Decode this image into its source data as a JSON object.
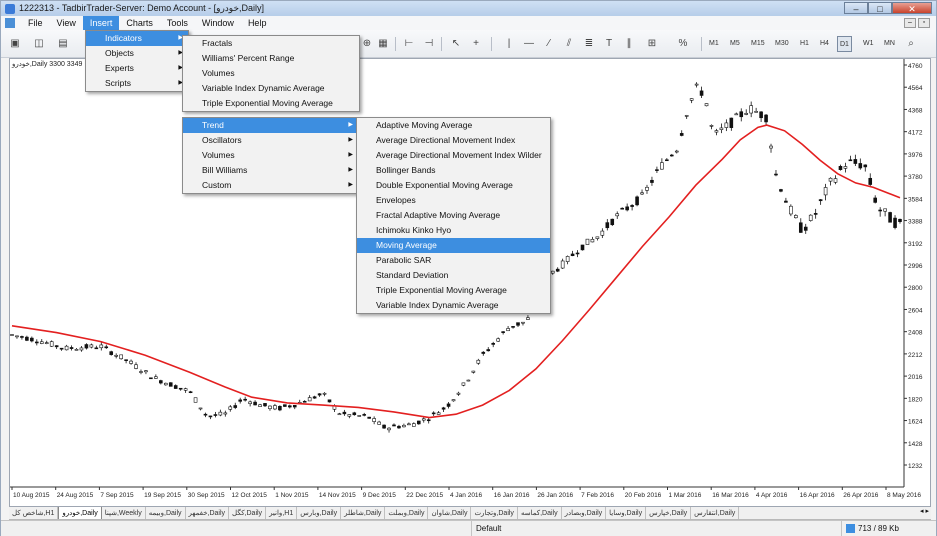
{
  "window": {
    "title": "1222313 - TadbirTrader-Server: Demo Account - [خودرو,Daily]",
    "controls": {
      "minimize": "–",
      "maximize": "□",
      "close": "✕"
    }
  },
  "menubar": {
    "items": [
      "File",
      "View",
      "Insert",
      "Charts",
      "Tools",
      "Window",
      "Help"
    ],
    "active": "Insert"
  },
  "toolbar": {
    "timeframes": [
      "M1",
      "M5",
      "M15",
      "M30",
      "H1",
      "H4",
      "D1",
      "W1",
      "MN"
    ],
    "selected_timeframe": "D1",
    "zoom_text": "%"
  },
  "chart": {
    "symbol_label": "خودرو,Daily 3300 3349",
    "price_labels": [
      "4760",
      "4564",
      "4368",
      "4172",
      "3976",
      "3780",
      "3584",
      "3388",
      "3192",
      "2996",
      "2800",
      "2604",
      "2408",
      "2212",
      "2016",
      "1820",
      "1624",
      "1428",
      "1232"
    ],
    "date_labels": [
      "10 Aug 2015",
      "24 Aug 2015",
      "7 Sep 2015",
      "19 Sep 2015",
      "30 Sep 2015",
      "12 Oct 2015",
      "1 Nov 2015",
      "14 Nov 2015",
      "9 Dec 2015",
      "22 Dec 2015",
      "4 Jan 2016",
      "16 Jan 2016",
      "26 Jan 2016",
      "7 Feb 2016",
      "20 Feb 2016",
      "1 Mar 2016",
      "16 Mar 2016",
      "4 Apr 2016",
      "16 Apr 2016",
      "26 Apr 2016",
      "8 May 2016"
    ],
    "ma_color": "#e32020",
    "close_path": [
      [
        0.0,
        2380
      ],
      [
        0.03,
        2330
      ],
      [
        0.06,
        2260
      ],
      [
        0.1,
        2280
      ],
      [
        0.13,
        2150
      ],
      [
        0.16,
        2000
      ],
      [
        0.2,
        1880
      ],
      [
        0.22,
        1660
      ],
      [
        0.24,
        1680
      ],
      [
        0.26,
        1820
      ],
      [
        0.28,
        1760
      ],
      [
        0.3,
        1730
      ],
      [
        0.32,
        1770
      ],
      [
        0.35,
        1860
      ],
      [
        0.37,
        1680
      ],
      [
        0.4,
        1660
      ],
      [
        0.42,
        1560
      ],
      [
        0.45,
        1590
      ],
      [
        0.47,
        1650
      ],
      [
        0.49,
        1750
      ],
      [
        0.51,
        1950
      ],
      [
        0.53,
        2200
      ],
      [
        0.56,
        2450
      ],
      [
        0.58,
        2500
      ],
      [
        0.6,
        2880
      ],
      [
        0.62,
        3000
      ],
      [
        0.64,
        3150
      ],
      [
        0.66,
        3250
      ],
      [
        0.68,
        3420
      ],
      [
        0.71,
        3600
      ],
      [
        0.73,
        3860
      ],
      [
        0.75,
        4040
      ],
      [
        0.76,
        4350
      ],
      [
        0.77,
        4560
      ],
      [
        0.78,
        4500
      ],
      [
        0.79,
        4130
      ],
      [
        0.81,
        4250
      ],
      [
        0.83,
        4380
      ],
      [
        0.85,
        4300
      ],
      [
        0.86,
        3800
      ],
      [
        0.875,
        3500
      ],
      [
        0.89,
        3300
      ],
      [
        0.905,
        3450
      ],
      [
        0.92,
        3700
      ],
      [
        0.94,
        3900
      ],
      [
        0.96,
        3880
      ],
      [
        0.975,
        3500
      ],
      [
        0.99,
        3400
      ],
      [
        1.0,
        3350
      ]
    ],
    "ma_path": [
      [
        0.0,
        2460
      ],
      [
        0.05,
        2400
      ],
      [
        0.1,
        2320
      ],
      [
        0.15,
        2200
      ],
      [
        0.2,
        2050
      ],
      [
        0.24,
        1920
      ],
      [
        0.27,
        1830
      ],
      [
        0.31,
        1780
      ],
      [
        0.35,
        1760
      ],
      [
        0.39,
        1740
      ],
      [
        0.43,
        1700
      ],
      [
        0.47,
        1650
      ],
      [
        0.5,
        1680
      ],
      [
        0.53,
        1760
      ],
      [
        0.56,
        1890
      ],
      [
        0.59,
        2080
      ],
      [
        0.62,
        2330
      ],
      [
        0.65,
        2600
      ],
      [
        0.68,
        2880
      ],
      [
        0.71,
        3160
      ],
      [
        0.74,
        3420
      ],
      [
        0.77,
        3700
      ],
      [
        0.8,
        3930
      ],
      [
        0.82,
        4100
      ],
      [
        0.84,
        4210
      ],
      [
        0.85,
        4230
      ],
      [
        0.87,
        4180
      ],
      [
        0.89,
        4060
      ],
      [
        0.91,
        3920
      ],
      [
        0.93,
        3800
      ],
      [
        0.95,
        3720
      ],
      [
        0.97,
        3680
      ],
      [
        0.99,
        3620
      ],
      [
        1.0,
        3590
      ]
    ]
  },
  "menus": {
    "insert": {
      "items": [
        {
          "label": "Indicators",
          "submenu": true,
          "highlight": true
        },
        {
          "label": "Objects",
          "submenu": true
        },
        {
          "label": "Experts",
          "submenu": true
        },
        {
          "label": "Scripts",
          "submenu": true
        }
      ]
    },
    "indicators": {
      "items": [
        "Fractals",
        "Williams' Percent Range",
        "Volumes",
        "Variable Index Dynamic Average",
        "Triple Exponential Moving Average"
      ]
    },
    "categories": {
      "items": [
        {
          "label": "Trend",
          "submenu": true,
          "highlight": true
        },
        {
          "label": "Oscillators",
          "submenu": true
        },
        {
          "label": "Volumes",
          "submenu": true
        },
        {
          "label": "Bill Williams",
          "submenu": true
        },
        {
          "label": "Custom",
          "submenu": true
        }
      ]
    },
    "trend": {
      "items": [
        "Adaptive Moving Average",
        "Average Directional Movement Index",
        "Average Directional Movement Index Wilder",
        "Bollinger Bands",
        "Double Exponential Moving Average",
        "Envelopes",
        "Fractal Adaptive Moving Average",
        "Ichimoku Kinko Hyo",
        "Moving Average",
        "Parabolic SAR",
        "Standard Deviation",
        "Triple Exponential Moving Average",
        "Variable Index Dynamic Average"
      ],
      "highlight": "Moving Average"
    }
  },
  "tabs": {
    "items": [
      "شاخص کل,H1",
      "خودرو,Daily",
      "شپنا,Weekly",
      "وبیمه,Daily",
      "خفمهر,Daily",
      "کگل,Daily",
      "وانیر,H1",
      "وبارس,Daily",
      "شاطلر,Daily",
      "وبملت,Daily",
      "شاوان,Daily",
      "وتجارت,Daily",
      "کماسه,Daily",
      "وبصادر,Daily",
      "وسایا,Daily",
      "خپارس,Daily",
      "انتقارس,Daily"
    ],
    "selected": "خودرو,Daily",
    "nav": "◂ ▸"
  },
  "statusbar": {
    "profile": "Default",
    "traffic": "713 / 89 Kb"
  }
}
